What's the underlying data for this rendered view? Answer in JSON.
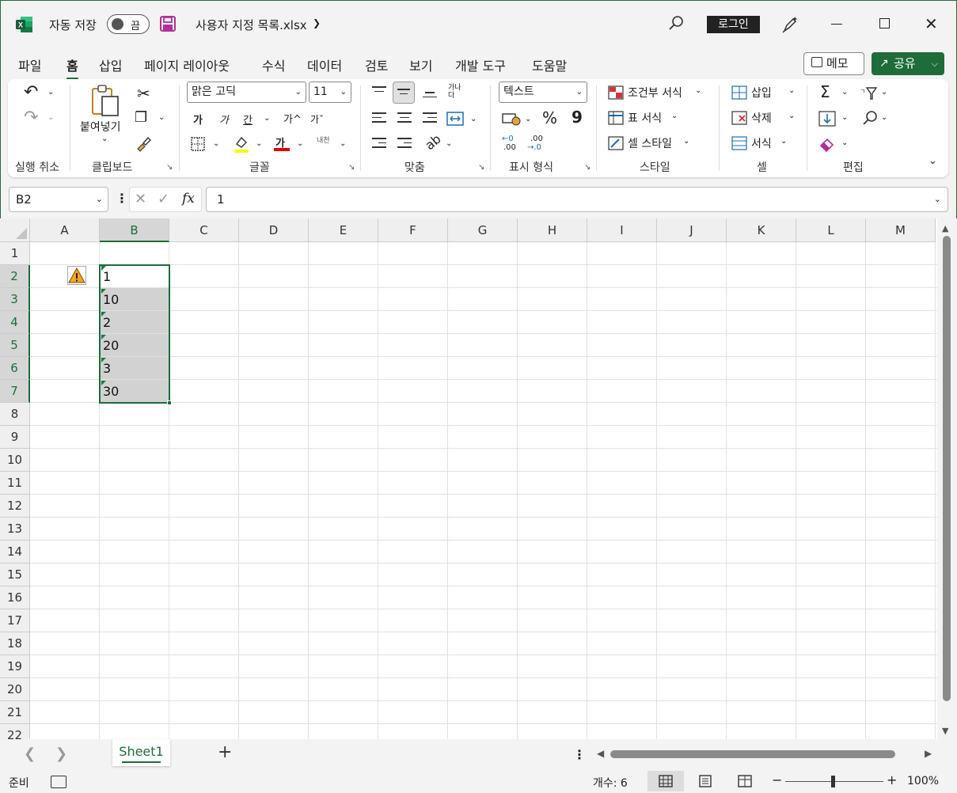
{
  "window": {
    "autosave_label": "자동 저장",
    "autosave_state": "끔",
    "doc_title": "사용자 지정 목록.xlsx",
    "login_label": "로그인",
    "accent_color": "#1e6c3a"
  },
  "menu": {
    "tabs": [
      {
        "label": "파일"
      },
      {
        "label": "홈"
      },
      {
        "label": "삽입"
      },
      {
        "label": "페이지 레이아웃"
      },
      {
        "label": "수식"
      },
      {
        "label": "데이터"
      },
      {
        "label": "검토"
      },
      {
        "label": "보기"
      },
      {
        "label": "개발 도구"
      },
      {
        "label": "도움말"
      }
    ],
    "active_tab": "홈",
    "memo_label": "메모",
    "share_label": "공유"
  },
  "ribbon": {
    "groups": {
      "undo": "실행 취소",
      "clipboard": "클립보드",
      "font": "글꼴",
      "alignment": "맞춤",
      "number": "표시 형식",
      "styles": "스타일",
      "cells": "셀",
      "editing": "편집"
    },
    "paste_label": "붙여넣기",
    "font_name": "맑은 고딕",
    "font_size": "11",
    "bold_glyph": "가",
    "italic_glyph": "가",
    "underline_glyph": "간",
    "grow_font_glyph": "가^",
    "shrink_font_glyph": "가ˇ",
    "font_color_glyph": "가",
    "phonetic_glyph": "내천",
    "wrap_glyph": "가나다",
    "number_format": "텍스트",
    "percent_glyph": "%",
    "comma_glyph": "9",
    "inc_decimal_top": "←0",
    "inc_decimal_bottom": ".00",
    "dec_decimal_top": ".00",
    "dec_decimal_bottom": "→.0",
    "conditional_format": "조건부 서식",
    "format_as_table": "표 서식",
    "cell_styles": "셀 스타일",
    "insert": "삽입",
    "delete": "삭제",
    "format": "서식",
    "sum_glyph": "Σ"
  },
  "formula_bar": {
    "name_box": "B2",
    "fx": "fx",
    "value": "1"
  },
  "sheet": {
    "columns": [
      "A",
      "B",
      "C",
      "D",
      "E",
      "F",
      "G",
      "H",
      "I",
      "J",
      "K",
      "L",
      "M"
    ],
    "rows": [
      "1",
      "2",
      "3",
      "4",
      "5",
      "6",
      "7",
      "8",
      "9",
      "10",
      "11",
      "12",
      "13",
      "14",
      "15",
      "16",
      "17",
      "18",
      "19",
      "20",
      "21",
      "22"
    ],
    "selected_column": "B",
    "selected_rows": [
      "2",
      "3",
      "4",
      "5",
      "6",
      "7"
    ],
    "cells": [
      {
        "ref": "B2",
        "value": "1"
      },
      {
        "ref": "B3",
        "value": "10"
      },
      {
        "ref": "B4",
        "value": "2"
      },
      {
        "ref": "B5",
        "value": "20"
      },
      {
        "ref": "B6",
        "value": "3"
      },
      {
        "ref": "B7",
        "value": "30"
      }
    ]
  },
  "sheet_tabs": {
    "tabs": [
      {
        "label": "Sheet1"
      }
    ],
    "add_label": "+"
  },
  "status": {
    "ready": "준비",
    "count": "개수: 6",
    "zoom_minus": "−",
    "zoom_plus": "+",
    "zoom": "100%"
  }
}
